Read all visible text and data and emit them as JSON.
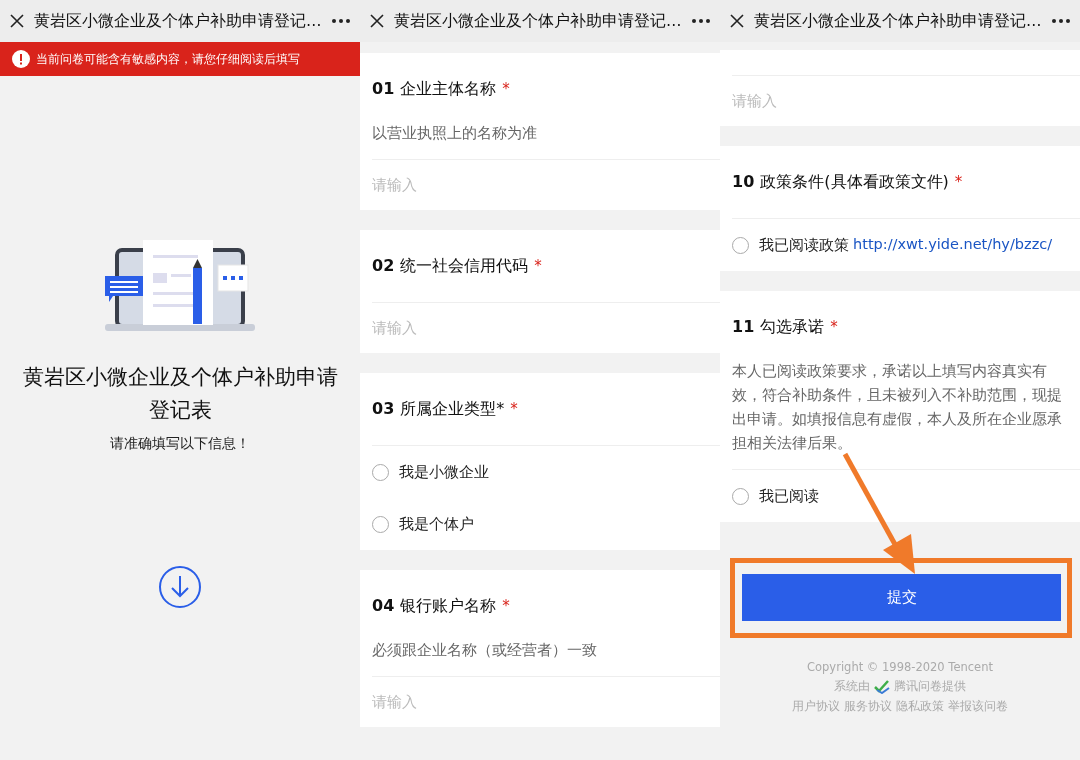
{
  "panels": [
    {
      "kind": "cover",
      "header": {
        "title": "黄岩区小微企业及个体户补助申请登记…"
      },
      "warning": "当前问卷可能含有敏感内容，请您仔细阅读后填写",
      "title": "黄岩区小微企业及个体户补助申请登记表",
      "subtitle": "请准确填写以下信息！"
    },
    {
      "kind": "questions",
      "header": {
        "title": "黄岩区小微企业及个体户补助申请登记…"
      },
      "questions": [
        {
          "kind": "input",
          "number": "01",
          "title": "企业主体名称",
          "required_mark": "*",
          "description": "以营业执照上的名称为准",
          "placeholder": "请输入"
        },
        {
          "kind": "input",
          "number": "02",
          "title": "统一社会信用代码",
          "required_mark": "*",
          "placeholder": "请输入"
        },
        {
          "kind": "radio",
          "number": "03",
          "title": "所属企业类型*",
          "required_mark": "*",
          "options": [
            {
              "label": "我是小微企业",
              "selected": false
            },
            {
              "label": "我是个体户",
              "selected": false
            }
          ]
        },
        {
          "kind": "input",
          "number": "04",
          "title": "银行账户名称",
          "required_mark": "*",
          "description": "必须跟企业名称（或经营者）一致",
          "placeholder": "请输入"
        }
      ]
    },
    {
      "kind": "questions",
      "header": {
        "title": "黄岩区小微企业及个体户补助申请登记…"
      },
      "questions": [
        {
          "kind": "input",
          "placeholder": "请输入"
        },
        {
          "kind": "radio",
          "number": "10",
          "title": "政策条件(具体看政策文件)",
          "required_mark": "*",
          "options": [
            {
              "label": "我已阅读政策",
              "link": "http://xwt.yide.net/hy/bzzc/",
              "selected": false
            }
          ]
        },
        {
          "kind": "radio",
          "number": "11",
          "title": "勾选承诺",
          "required_mark": "*",
          "description": "本人已阅读政策要求，承诺以上填写内容真实有效，符合补助条件，且未被列入不补助范围，现提出申请。如填报信息有虚假，本人及所在企业愿承担相关法律后果。",
          "options": [
            {
              "label": "我已阅读",
              "selected": false
            }
          ]
        }
      ],
      "submit": {
        "label": "提交",
        "highlighted": true
      },
      "footer": {
        "copyright": "Copyright © 1998-2020 Tencent",
        "provider_prefix": "系统由",
        "provider": "腾讯问卷提供",
        "links": [
          "用户协议",
          "服务协议",
          "隐私政策",
          "举报该问卷"
        ]
      }
    }
  ]
}
